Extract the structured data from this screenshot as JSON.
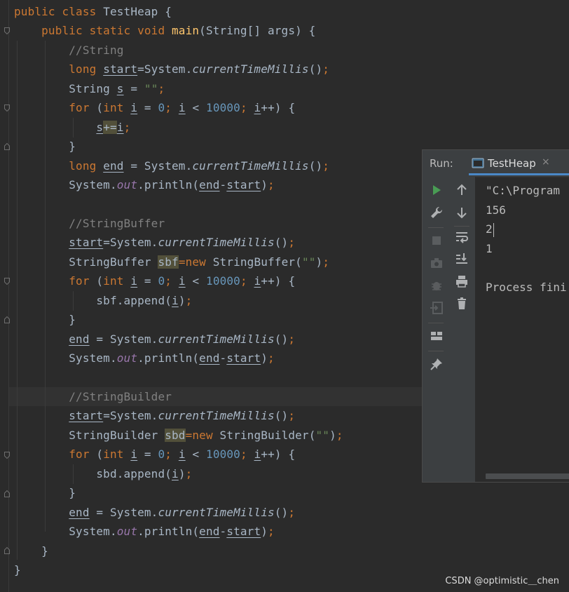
{
  "editor": {
    "lines": [
      {
        "tokens": [
          [
            "kw",
            "public class "
          ],
          [
            "",
            "TestHeap {"
          ]
        ]
      },
      {
        "tokens": [
          [
            "",
            "    "
          ],
          [
            "kw",
            "public static void "
          ],
          [
            "fn",
            "main"
          ],
          [
            "",
            "(String[] args) {"
          ]
        ]
      },
      {
        "tokens": [
          [
            "",
            "        "
          ],
          [
            "cm",
            "//String"
          ]
        ]
      },
      {
        "tokens": [
          [
            "",
            "        "
          ],
          [
            "kw",
            "long "
          ],
          [
            "u",
            "start"
          ],
          [
            "",
            "=System."
          ],
          [
            "it",
            "currentTimeMillis"
          ],
          [
            "",
            "()"
          ],
          [
            "kw",
            ";"
          ]
        ]
      },
      {
        "tokens": [
          [
            "",
            "        String "
          ],
          [
            "u",
            "s"
          ],
          [
            "",
            " = "
          ],
          [
            "str",
            "\"\""
          ],
          [
            "kw",
            ";"
          ]
        ]
      },
      {
        "tokens": [
          [
            "",
            "        "
          ],
          [
            "kw",
            "for "
          ],
          [
            "",
            "("
          ],
          [
            "kw",
            "int "
          ],
          [
            "u",
            "i"
          ],
          [
            "",
            " = "
          ],
          [
            "num",
            "0"
          ],
          [
            "kw",
            "; "
          ],
          [
            "u",
            "i"
          ],
          [
            "",
            " < "
          ],
          [
            "num",
            "10000"
          ],
          [
            "kw",
            "; "
          ],
          [
            "u",
            "i"
          ],
          [
            "",
            "++) {"
          ]
        ]
      },
      {
        "tokens": [
          [
            "",
            "            "
          ],
          [
            "u",
            "s"
          ],
          [
            "hl",
            "+="
          ],
          [
            "u",
            "i"
          ],
          [
            "kw",
            ";"
          ]
        ]
      },
      {
        "tokens": [
          [
            "",
            "        }"
          ]
        ]
      },
      {
        "tokens": [
          [
            "",
            "        "
          ],
          [
            "kw",
            "long "
          ],
          [
            "u",
            "end"
          ],
          [
            "",
            " = System."
          ],
          [
            "it",
            "currentTimeMillis"
          ],
          [
            "",
            "()"
          ],
          [
            "kw",
            ";"
          ]
        ]
      },
      {
        "tokens": [
          [
            "",
            "        System."
          ],
          [
            "fld",
            "out"
          ],
          [
            "",
            ".println("
          ],
          [
            "u",
            "end"
          ],
          [
            "",
            "-"
          ],
          [
            "u",
            "start"
          ],
          [
            "",
            ")"
          ],
          [
            "kw",
            ";"
          ]
        ]
      },
      {
        "tokens": []
      },
      {
        "tokens": [
          [
            "",
            "        "
          ],
          [
            "cm",
            "//StringBuffer"
          ]
        ]
      },
      {
        "tokens": [
          [
            "",
            "        "
          ],
          [
            "u",
            "start"
          ],
          [
            "",
            "=System."
          ],
          [
            "it",
            "currentTimeMillis"
          ],
          [
            "",
            "()"
          ],
          [
            "kw",
            ";"
          ]
        ]
      },
      {
        "tokens": [
          [
            "",
            "        StringBuffer "
          ],
          [
            "hl",
            "sbf"
          ],
          [
            "kw",
            "="
          ],
          [
            "kw",
            "new "
          ],
          [
            "",
            "StringBuffer("
          ],
          [
            "str",
            "\"\""
          ],
          [
            "",
            ")"
          ],
          [
            "kw",
            ";"
          ]
        ]
      },
      {
        "tokens": [
          [
            "",
            "        "
          ],
          [
            "kw",
            "for "
          ],
          [
            "",
            "("
          ],
          [
            "kw",
            "int "
          ],
          [
            "u",
            "i"
          ],
          [
            "",
            " = "
          ],
          [
            "num",
            "0"
          ],
          [
            "kw",
            "; "
          ],
          [
            "u",
            "i"
          ],
          [
            "",
            " < "
          ],
          [
            "num",
            "10000"
          ],
          [
            "kw",
            "; "
          ],
          [
            "u",
            "i"
          ],
          [
            "",
            "++) {"
          ]
        ]
      },
      {
        "tokens": [
          [
            "",
            "            sbf.append("
          ],
          [
            "u",
            "i"
          ],
          [
            "",
            ")"
          ],
          [
            "kw",
            ";"
          ]
        ]
      },
      {
        "tokens": [
          [
            "",
            "        }"
          ]
        ]
      },
      {
        "tokens": [
          [
            "",
            "        "
          ],
          [
            "u",
            "end"
          ],
          [
            "",
            " = System."
          ],
          [
            "it",
            "currentTimeMillis"
          ],
          [
            "",
            "()"
          ],
          [
            "kw",
            ";"
          ]
        ]
      },
      {
        "tokens": [
          [
            "",
            "        System."
          ],
          [
            "fld",
            "out"
          ],
          [
            "",
            ".println("
          ],
          [
            "u",
            "end"
          ],
          [
            "",
            "-"
          ],
          [
            "u",
            "start"
          ],
          [
            "",
            ")"
          ],
          [
            "kw",
            ";"
          ]
        ]
      },
      {
        "tokens": []
      },
      {
        "tokens": [
          [
            "",
            "        "
          ],
          [
            "cm",
            "//StringBuilder"
          ]
        ]
      },
      {
        "tokens": [
          [
            "",
            "        "
          ],
          [
            "u",
            "start"
          ],
          [
            "",
            "=System."
          ],
          [
            "it",
            "currentTimeMillis"
          ],
          [
            "",
            "()"
          ],
          [
            "kw",
            ";"
          ]
        ]
      },
      {
        "tokens": [
          [
            "",
            "        StringBuilder "
          ],
          [
            "hl",
            "sbd"
          ],
          [
            "kw",
            "="
          ],
          [
            "kw",
            "new "
          ],
          [
            "",
            "StringBuilder("
          ],
          [
            "str",
            "\"\""
          ],
          [
            "",
            ")"
          ],
          [
            "kw",
            ";"
          ]
        ]
      },
      {
        "tokens": [
          [
            "",
            "        "
          ],
          [
            "kw",
            "for "
          ],
          [
            "",
            "("
          ],
          [
            "kw",
            "int "
          ],
          [
            "u",
            "i"
          ],
          [
            "",
            " = "
          ],
          [
            "num",
            "0"
          ],
          [
            "kw",
            "; "
          ],
          [
            "u",
            "i"
          ],
          [
            "",
            " < "
          ],
          [
            "num",
            "10000"
          ],
          [
            "kw",
            "; "
          ],
          [
            "u",
            "i"
          ],
          [
            "",
            "++) {"
          ]
        ]
      },
      {
        "tokens": [
          [
            "",
            "            sbd.append("
          ],
          [
            "u",
            "i"
          ],
          [
            "",
            ")"
          ],
          [
            "kw",
            ";"
          ]
        ]
      },
      {
        "tokens": [
          [
            "",
            "        }"
          ]
        ]
      },
      {
        "tokens": [
          [
            "",
            "        "
          ],
          [
            "u",
            "end"
          ],
          [
            "",
            " = System."
          ],
          [
            "it",
            "currentTimeMillis"
          ],
          [
            "",
            "()"
          ],
          [
            "kw",
            ";"
          ]
        ]
      },
      {
        "tokens": [
          [
            "",
            "        System."
          ],
          [
            "fld",
            "out"
          ],
          [
            "",
            ".println("
          ],
          [
            "u",
            "end"
          ],
          [
            "",
            "-"
          ],
          [
            "u",
            "start"
          ],
          [
            "",
            ")"
          ],
          [
            "kw",
            ";"
          ]
        ]
      },
      {
        "tokens": [
          [
            "",
            "    }"
          ]
        ]
      },
      {
        "tokens": [
          [
            "",
            "}"
          ]
        ]
      }
    ]
  },
  "run_panel": {
    "label": "Run:",
    "tab_name": "TestHeap",
    "tab_close": "×",
    "console": [
      "\"C:\\Program",
      "156",
      "2",
      "1",
      "",
      "Process fini"
    ]
  },
  "watermark": "CSDN @optimistic＿chen",
  "colors": {
    "keyword": "#cc7832",
    "number": "#6897bb",
    "comment": "#808080",
    "method": "#ffc66d",
    "field": "#9876aa",
    "string": "#6a8759",
    "accent": "#4a88c7",
    "run_green": "#499c54"
  }
}
